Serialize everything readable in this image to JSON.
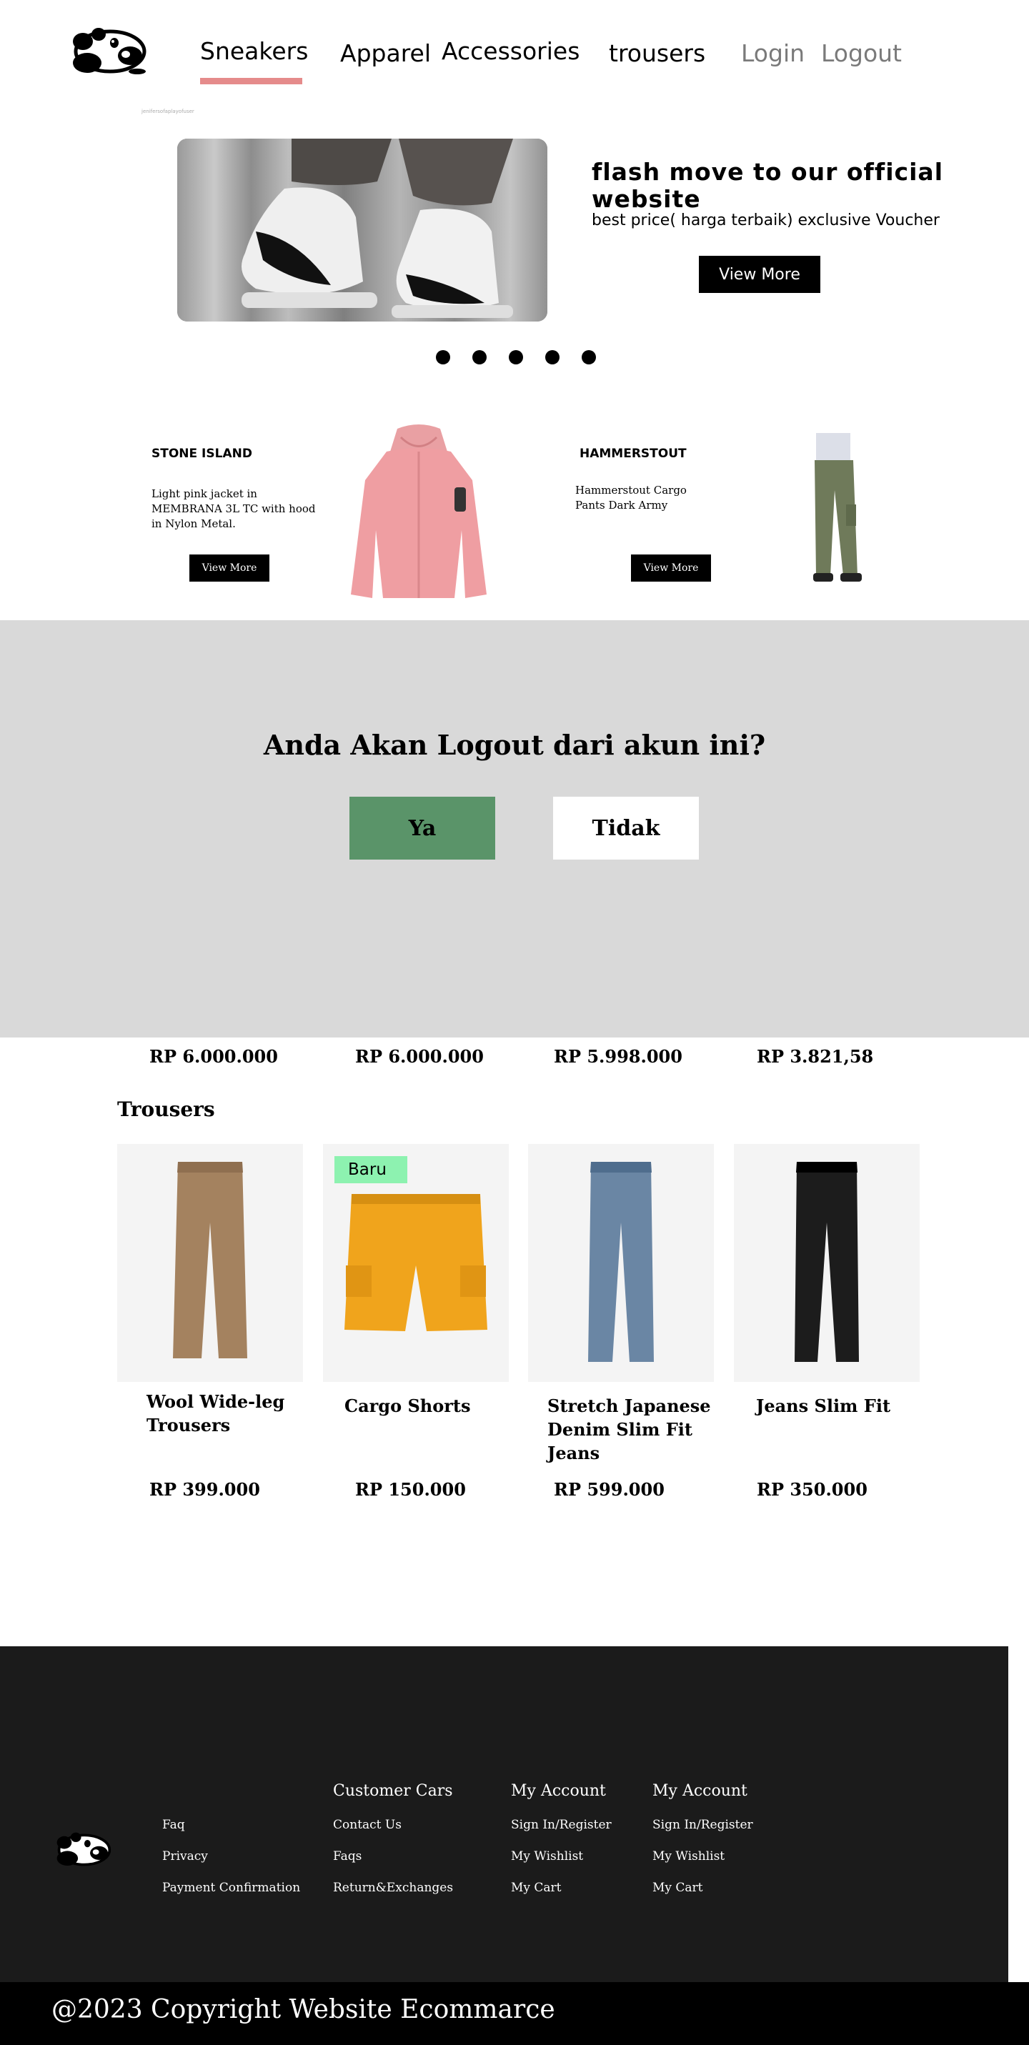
{
  "nav": {
    "items": [
      {
        "label": "Sneakers"
      },
      {
        "label": "Apparel"
      },
      {
        "label": "Accessories"
      },
      {
        "label": "trousers"
      }
    ],
    "login_label": "Login",
    "logout_label": "Logout",
    "active_index": 0,
    "underline_color": "#e58b8b"
  },
  "tiny_text": "jenifersofaplayofuser",
  "hero": {
    "title": "flash move to our official website",
    "subtitle": "best price( harga terbaik) exclusive Voucher",
    "button_label": "View More",
    "slide_count": 5
  },
  "promos": [
    {
      "brand": "STONE ISLAND",
      "description": "Light pink jacket in MEMBRANA 3L TC with hood in Nylon Metal.",
      "button_label": "View More"
    },
    {
      "brand": "HAMMERSTOUT",
      "description": "Hammerstout Cargo Pants Dark Army",
      "button_label": "View More"
    }
  ],
  "logout_dialog": {
    "question": "Anda Akan Logout dari akun ini?",
    "yes_label": "Ya",
    "no_label": "Tidak",
    "yes_color": "#5a9469"
  },
  "top_prices": [
    "RP 6.000.000",
    "RP 6.000.000",
    "RP  5.998.000",
    "RP  3.821,58"
  ],
  "trousers": {
    "title": "Trousers",
    "products": [
      {
        "name": "Wool Wide-leg Trousers",
        "price": "RP 399.000",
        "color": "#a4825f",
        "badge": ""
      },
      {
        "name": "Cargo Shorts",
        "price": "RP 150.000",
        "color": "#f0a41c",
        "badge": "Baru"
      },
      {
        "name": "Stretch Japanese Denim Slim Fit Jeans",
        "price": "RP  599.000",
        "color": "#6a86a4",
        "badge": ""
      },
      {
        "name": "Jeans Slim Fit",
        "price": "RP  350.000",
        "color": "#1c1c1c",
        "badge": ""
      }
    ]
  },
  "footer": {
    "col1": [
      "Faq",
      "Privacy",
      "Payment Confirmation"
    ],
    "col2": {
      "title": "Customer Cars",
      "links": [
        "Contact Us",
        "Faqs",
        "Return&Exchanges"
      ]
    },
    "col3": {
      "title": "My Account",
      "links": [
        "Sign In/Register",
        "My Wishlist",
        "My Cart"
      ]
    },
    "col4": {
      "title": "My Account",
      "links": [
        "Sign In/Register",
        "My Wishlist",
        "My Cart"
      ]
    },
    "copyright": "@2023 Copyright Website Ecommarce"
  }
}
